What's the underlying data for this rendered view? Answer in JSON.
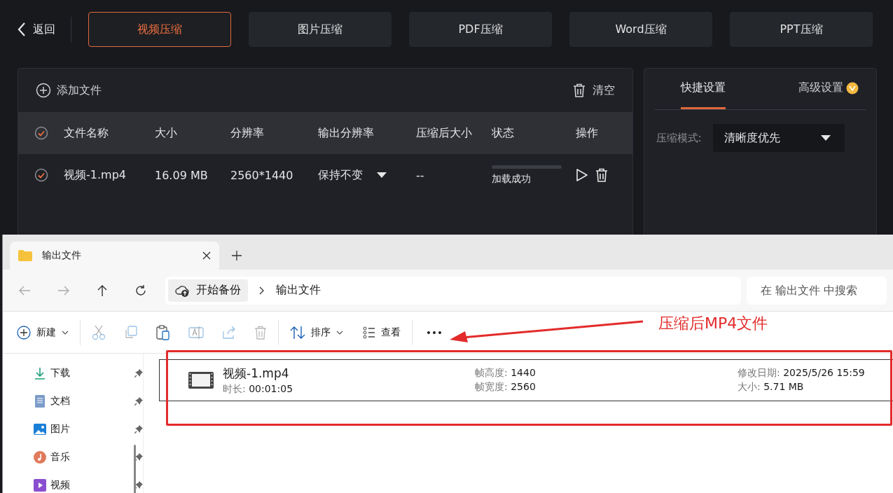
{
  "app": {
    "back_label": "返回",
    "tabs": [
      {
        "label": "视频压缩",
        "selected": true
      },
      {
        "label": "图片压缩",
        "selected": false
      },
      {
        "label": "PDF压缩",
        "selected": false
      },
      {
        "label": "Word压缩",
        "selected": false
      },
      {
        "label": "PPT压缩",
        "selected": false
      }
    ],
    "file_panel": {
      "add_label": "添加文件",
      "clear_label": "清空",
      "header_checked": true,
      "columns": [
        "文件名称",
        "大小",
        "分辨率",
        "输出分辨率",
        "压缩后大小",
        "状态",
        "操作"
      ],
      "rows": [
        {
          "checked": true,
          "name": "视频-1.mp4",
          "size": "16.09 MB",
          "resolution": "2560*1440",
          "output_resolution": "保持不变",
          "compressed_size": "--",
          "status": "加载成功",
          "level": 0
        }
      ]
    },
    "settings": {
      "tabs": [
        {
          "label": "快捷设置",
          "selected": true
        },
        {
          "label": "高级设置",
          "selected": false
        }
      ],
      "mode_label": "压缩模式:",
      "mode_value": "清晰度优先"
    }
  },
  "explorer": {
    "tab_title": "输出文件",
    "breadcrumb": [
      "开始备份",
      "输出文件"
    ],
    "search_placeholder": "在 输出文件 中搜索",
    "new_label": "新建",
    "sort_label": "排序",
    "view_label": "查看",
    "nav_items": [
      {
        "kind": "download",
        "label": "下载"
      },
      {
        "kind": "documents",
        "label": "文档"
      },
      {
        "kind": "pictures",
        "label": "图片"
      },
      {
        "kind": "music",
        "label": "音乐"
      },
      {
        "kind": "videos",
        "label": "视频"
      }
    ],
    "files": [
      {
        "name": "视频-1.mp4",
        "details": [
          {
            "label": "时长:",
            "value": "00:01:05"
          },
          {
            "label": "帧高度:",
            "value": "1440"
          },
          {
            "label": "帧宽度:",
            "value": "2560"
          },
          {
            "label": "修改日期:",
            "value": "2025/5/26 15:59"
          },
          {
            "label": "大小:",
            "value": "5.71 MB"
          }
        ]
      }
    ]
  },
  "annotation": {
    "text": "压缩后MP4文件"
  }
}
